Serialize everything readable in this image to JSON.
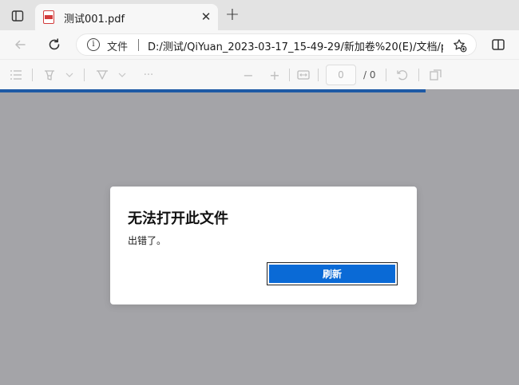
{
  "browser": {
    "tab": {
      "title": "测试001.pdf",
      "close_glyph": "✕",
      "favicon": "pdf-file-icon"
    },
    "new_tab_glyph": "+",
    "address_bar": {
      "site_info_glyph": "i",
      "scheme_label": "文件",
      "url": "D:/测试/QiYuan_2023-03-17_15-49-29/新加卷%20(E)/文档/p..."
    }
  },
  "pdf_toolbar": {
    "page_input": "0",
    "page_total": "/ 0",
    "zoom_out_glyph": "−",
    "zoom_in_glyph": "+",
    "more_glyph": "···"
  },
  "load_progress": 0.82,
  "dialog": {
    "title": "无法打开此文件",
    "message": "出错了。",
    "button_label": "刷新"
  },
  "colors": {
    "accent": "#0a6ad6",
    "progress": "#1e5aa5",
    "viewer_background": "#a4a4a8"
  }
}
